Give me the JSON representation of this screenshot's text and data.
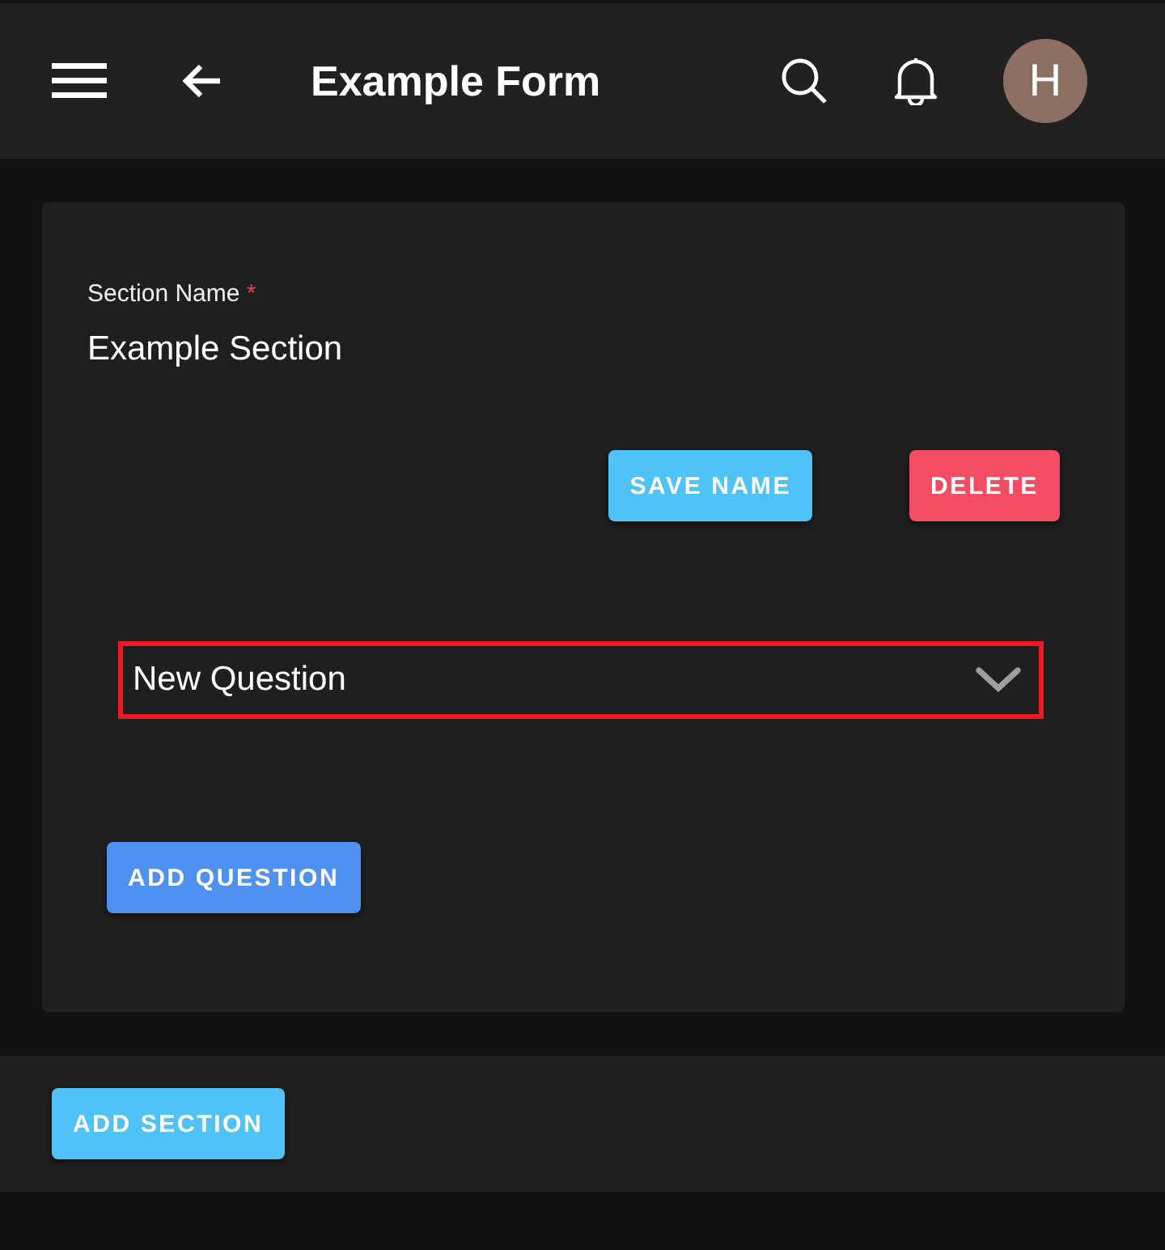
{
  "app_bar": {
    "title": "Example Form",
    "avatar_letter": "H"
  },
  "section": {
    "label": "Section Name",
    "required_mark": "*",
    "value": "Example Section",
    "buttons": [
      {
        "label": "SAVE NAME",
        "kind": "save"
      },
      {
        "label": "DELETE",
        "kind": "danger"
      }
    ],
    "questions": [
      {
        "title": "New Question",
        "expanded": false,
        "highlighted": true
      }
    ],
    "add_question": "ADD QUESTION"
  },
  "add_section": "ADD SECTION"
}
